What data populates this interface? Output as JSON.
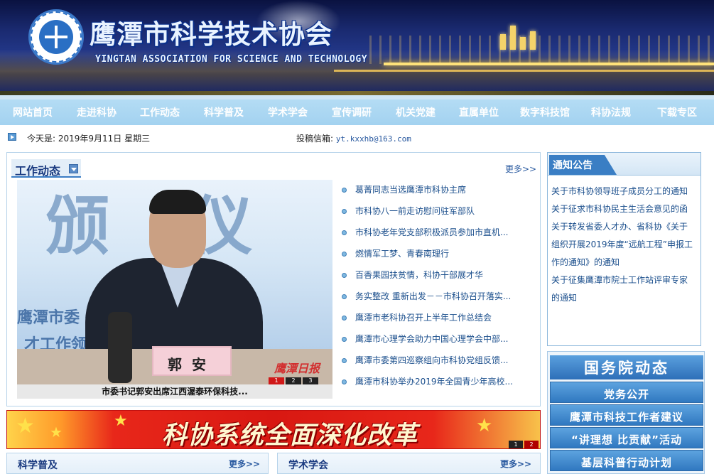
{
  "header": {
    "title": "鹰潭市科学技术协会",
    "subtitle": "YINGTAN ASSOCIATION FOR SCIENCE AND TECHNOLOGY"
  },
  "nav": {
    "items": [
      "网站首页",
      "走进科协",
      "工作动态",
      "科学普及",
      "学术学会",
      "宣传调研",
      "机关党建",
      "直属单位",
      "数字科技馆",
      "科协法规",
      "下载专区"
    ]
  },
  "datebar": {
    "today": "今天是: 2019年9月11日 星期三",
    "mail_label": "投稿信箱: ",
    "mail": "yt.kxxhb@163.com"
  },
  "work": {
    "title": "工作动态",
    "more": "更多>>",
    "photo": {
      "bg_text_big": "颁 仪",
      "bg_text_1": "鹰潭市委 ～组办公",
      "bg_text_2": "才工作领 贵溪市",
      "nameplate": "郭安",
      "stamp": "鹰潭日报",
      "pager": [
        "1",
        "2",
        "3"
      ],
      "caption": "市委书记郭安出席江西渥泰环保科技..."
    },
    "news": [
      "葛菁同志当选鹰潭市科协主席",
      "市科协八一前走访慰问驻军部队",
      "市科协老年党支部积极派员参加市直机...",
      "燃情军工梦、青春南理行",
      "百香果园扶贫情，科协干部展才华",
      "务实整改 重新出发－－市科协召开落实...",
      "鹰潭市老科协召开上半年工作总结会",
      "鹰潭市心理学会助力中国心理学会中部...",
      "鹰潭市委第四巡察组向市科协党组反馈...",
      "鹰潭市科协举办2019年全国青少年高校..."
    ]
  },
  "notice": {
    "title": "通知公告",
    "items": [
      "关于市科协领导班子成员分工的通知",
      "关于征求市科协民主生活会意见的函",
      "关于转发省委人才办、省科协《关于组织开展2019年度“远航工程”申报工作的通知》的通知",
      "关于征集鹰潭市院士工作站评审专家的通知"
    ]
  },
  "links": {
    "hero": "国务院动态",
    "buttons": [
      "党务公开",
      "鹰潭市科技工作者建议",
      "“讲理想 比贡献”活动",
      "基层科普行动计划"
    ]
  },
  "banner2": {
    "slogan": "科协系统全面深化改革",
    "pager": [
      "1",
      "2"
    ]
  },
  "bottom": {
    "left_title": "科学普及",
    "left_more": "更多>>",
    "right_title": "学术学会",
    "right_more": "更多>>"
  },
  "colors": {
    "nav_bg": "#a8d6f2",
    "link_blue": "#1a4e8c",
    "accent_red": "#d81812"
  }
}
